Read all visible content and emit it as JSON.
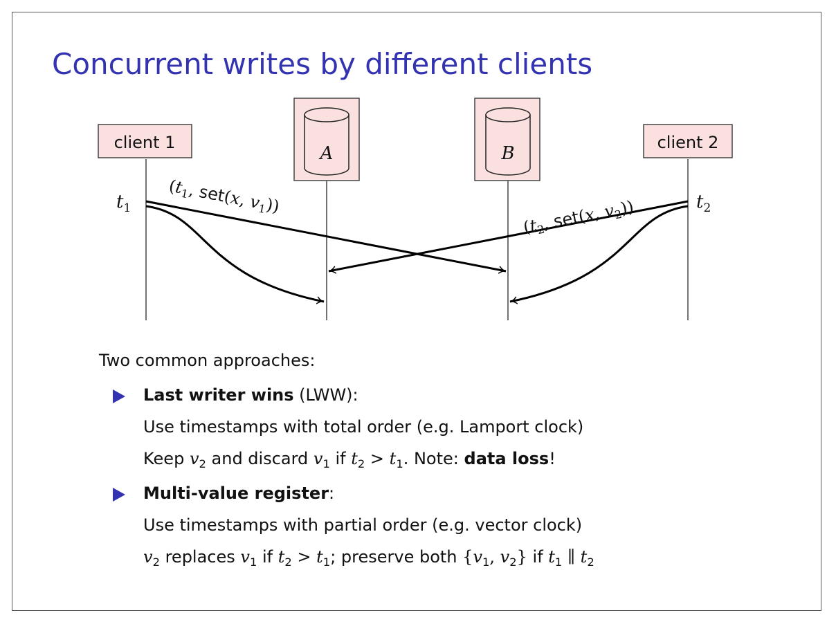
{
  "title": "Concurrent writes by different clients",
  "diagram": {
    "client1": "client 1",
    "client2": "client 2",
    "replicaA": "A",
    "replicaB": "B",
    "t1_base": "t",
    "t1_sub": "1",
    "t2_base": "t",
    "t2_sub": "2",
    "msg1": {
      "open": "(",
      "t": "t",
      "tsub": "1",
      "comma": ", ",
      "fn": "set",
      "args_open": "(",
      "x": "x",
      "argcomma": ", ",
      "v": "v",
      "vsub": "1",
      "close": "))"
    },
    "msg2": {
      "open": "(",
      "t": "t",
      "tsub": "2",
      "comma": ", ",
      "fn": "set",
      "args_open": "(",
      "x": "x",
      "argcomma": ", ",
      "v": "v",
      "vsub": "2",
      "close": "))"
    },
    "node_fill": "#fbe0e0",
    "node_stroke": "#444444"
  },
  "body": {
    "intro": "Two common approaches:",
    "bullet1": {
      "head": "Last writer wins",
      "head_rest": " (LWW):",
      "line1": "Use timestamps with total order (e.g. Lamport clock)",
      "line2_a": "Keep ",
      "line2_v2": "v",
      "line2_v2sub": "2",
      "line2_b": " and discard ",
      "line2_v1": "v",
      "line2_v1sub": "1",
      "line2_c": " if ",
      "line2_t2": "t",
      "line2_t2sub": "2",
      "line2_gt": " > ",
      "line2_t1": "t",
      "line2_t1sub": "1",
      "line2_d": ". Note: ",
      "line2_bold": "data loss",
      "line2_e": "!"
    },
    "bullet2": {
      "head": "Multi-value register",
      "head_rest": ":",
      "line1": "Use timestamps with partial order (e.g. vector clock)",
      "line2_v2": "v",
      "line2_v2sub": "2",
      "line2_a": " replaces ",
      "line2_v1": "v",
      "line2_v1sub": "1",
      "line2_b": " if ",
      "line2_t2": "t",
      "line2_t2sub": "2",
      "line2_gt": " > ",
      "line2_t1": "t",
      "line2_t1sub": "1",
      "line2_c": "; preserve both ",
      "line2_set_open": "{",
      "line2_sv1": "v",
      "line2_sv1sub": "1",
      "line2_setcomma": ", ",
      "line2_sv2": "v",
      "line2_sv2sub": "2",
      "line2_set_close": "}",
      "line2_d": " if ",
      "line2_pt1": "t",
      "line2_pt1sub": "1",
      "line2_par": " ∥ ",
      "line2_pt2": "t",
      "line2_pt2sub": "2"
    },
    "accent": "#3333b2"
  }
}
